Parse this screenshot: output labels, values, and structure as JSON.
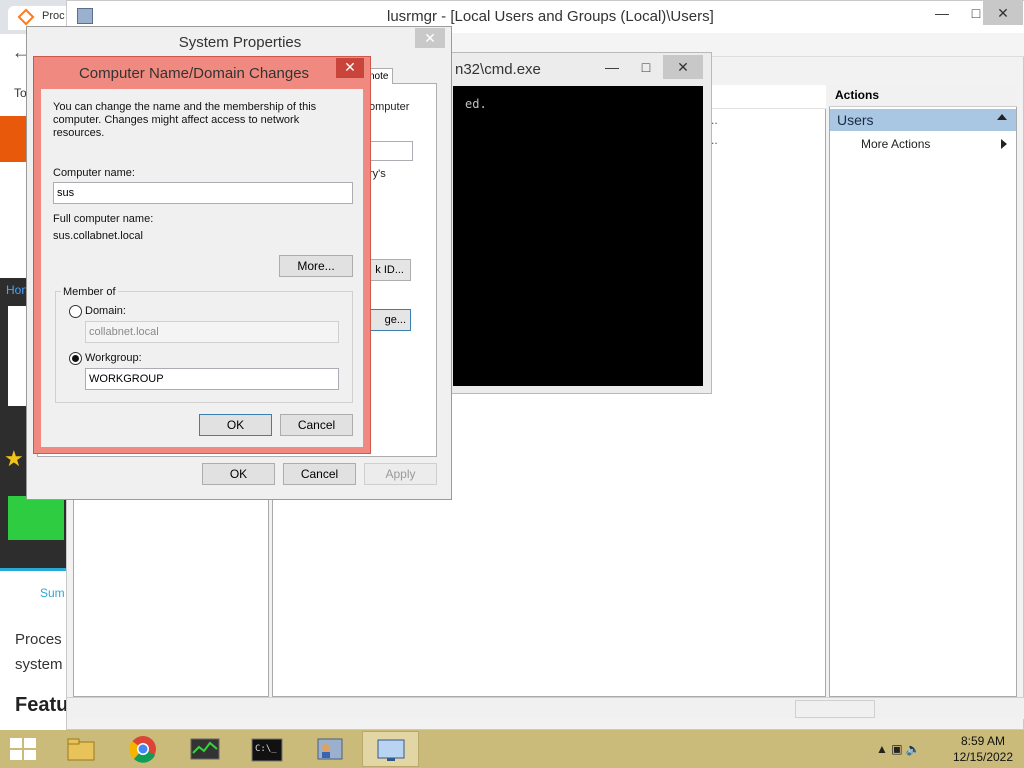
{
  "browser": {
    "tab_label": "Proc",
    "side_text_to": "To",
    "home_link": "Hon",
    "sum_link": "Sum",
    "body_line1": "Proces",
    "body_line2": "system",
    "heading": "Featu"
  },
  "mmc": {
    "title": "lusrmgr - [Local Users and Groups (Local)\\Users]",
    "actions_header": "Actions",
    "users_label": "Users",
    "more_actions": "More Actions",
    "row_ellipsis_1": "..",
    "row_ellipsis_2": ".."
  },
  "cmd": {
    "title": "n32\\cmd.exe",
    "console_text": "ed."
  },
  "system_properties": {
    "title": "System Properties",
    "tab_remote": "note",
    "text_computer": "omputer",
    "text_history": "ry's",
    "network_id_button": "k ID...",
    "change_button": "ge...",
    "ok": "OK",
    "cancel": "Cancel",
    "apply": "Apply"
  },
  "computer_name_dialog": {
    "title": "Computer Name/Domain Changes",
    "description": "You can change the name and the membership of this computer. Changes might affect access to network resources.",
    "computer_name_label": "Computer name:",
    "computer_name_value": "sus",
    "full_name_label": "Full computer name:",
    "full_name_value": "sus.collabnet.local",
    "more_button": "More...",
    "member_of_label": "Member of",
    "domain_label": "Domain:",
    "domain_value": "collabnet.local",
    "workgroup_label": "Workgroup:",
    "workgroup_value": "WORKGROUP",
    "selected_membership": "Workgroup",
    "ok": "OK",
    "cancel": "Cancel"
  },
  "taskbar": {
    "apps": [
      "file-explorer",
      "chrome",
      "task-manager",
      "cmd",
      "users-manager",
      "system-properties"
    ],
    "active_app": "system-properties",
    "time": "8:59 AM",
    "date": "12/15/2022"
  },
  "colors": {
    "taskbar": "#cbbb7a",
    "dialog_frame": "#f08a80",
    "selection": "#a9c6e3"
  }
}
